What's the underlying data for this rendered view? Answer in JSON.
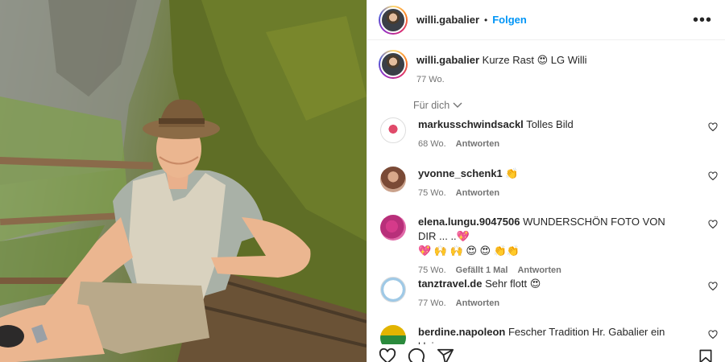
{
  "post": {
    "username": "willi.gabalier",
    "dot": "•",
    "follow_label": "Folgen",
    "more_label": "•••"
  },
  "caption": {
    "username": "willi.gabalier",
    "text": "Kurze Rast 😍 LG Willi",
    "time": "77 Wo."
  },
  "filter_label": "Für dich",
  "comments": [
    {
      "username": "markusschwindsackl",
      "text": "Tolles Bild",
      "time": "68 Wo.",
      "reply": "Antworten"
    },
    {
      "username": "yvonne_schenk1",
      "text": "👏",
      "time": "75 Wo.",
      "reply": "Antworten"
    },
    {
      "username": "elena.lungu.9047506",
      "text": "WUNDERSCHÖN FOTO VON DIR ... ..💖",
      "text2": "💖 🙌 🙌 😍 😍 👏👏",
      "time": "75 Wo.",
      "likes": "Gefällt 1 Mal",
      "reply": "Antworten"
    },
    {
      "username": "tanztravel.de",
      "text": "Sehr flott 😍",
      "time": "77 Wo.",
      "reply": "Antworten"
    },
    {
      "username": "berdine.napoleon",
      "text": "Fescher Tradition Hr. Gabalier ein kleine",
      "time": "",
      "reply": ""
    }
  ],
  "icons": {
    "like": "heart-icon",
    "comment": "comment-icon",
    "share": "share-icon",
    "save": "bookmark-icon"
  }
}
